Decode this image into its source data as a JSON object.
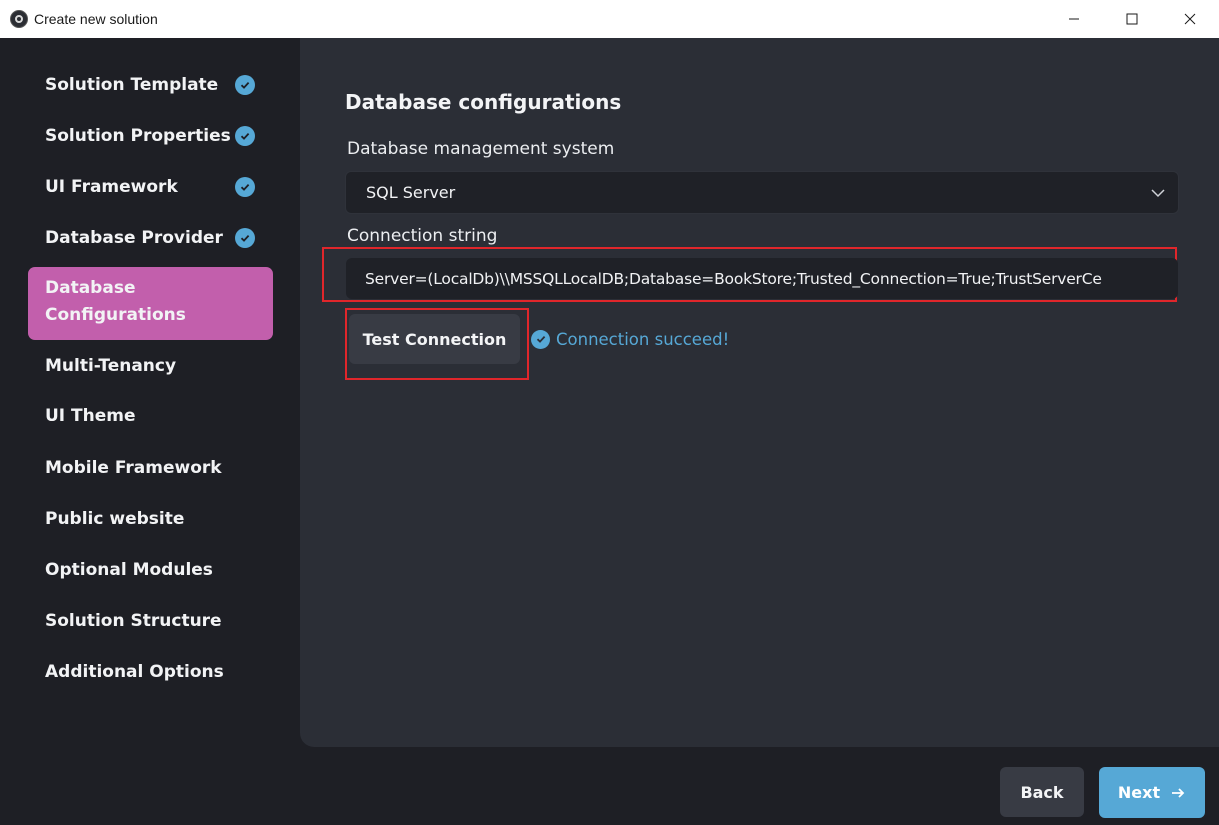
{
  "window": {
    "title": "Create new solution",
    "controls": {
      "minimize": "minimize-icon",
      "maximize": "maximize-icon",
      "close": "close-icon"
    }
  },
  "sidebar": {
    "items": [
      {
        "label": "Solution Template",
        "completed": true
      },
      {
        "label": "Solution Properties",
        "completed": true
      },
      {
        "label": "UI Framework",
        "completed": true
      },
      {
        "label": "Database Provider",
        "completed": true
      },
      {
        "label": "Database Configurations",
        "active": true
      },
      {
        "label": "Multi-Tenancy"
      },
      {
        "label": "UI Theme"
      },
      {
        "label": "Mobile Framework"
      },
      {
        "label": "Public website"
      },
      {
        "label": "Optional Modules"
      },
      {
        "label": "Solution Structure"
      },
      {
        "label": "Additional Options"
      }
    ]
  },
  "main": {
    "title": "Database configurations",
    "dbms_label": "Database management system",
    "dbms_value": "SQL Server",
    "connection_label": "Connection string",
    "connection_value": "Server=(LocalDb)\\\\MSSQLLocalDB;Database=BookStore;Trusted_Connection=True;TrustServerCe",
    "test_button": "Test Connection",
    "status_text": "Connection succeed!"
  },
  "footer": {
    "back_label": "Back",
    "next_label": "Next"
  },
  "colors": {
    "accent": "#56a8d6",
    "active_item": "#c25fac",
    "highlight_border": "#e0262b",
    "panel_bg": "#2b2e36",
    "window_bg": "#1e1f25"
  }
}
